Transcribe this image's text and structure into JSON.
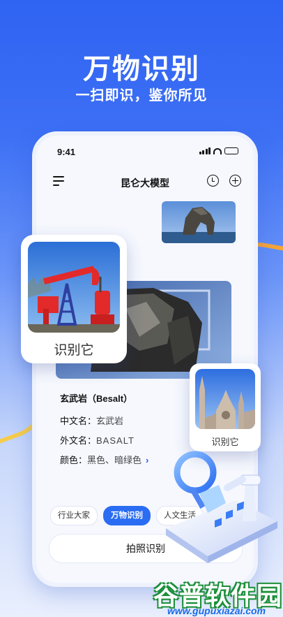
{
  "hero": {
    "title": "万物识别",
    "subtitle": "一扫即识，鉴你所见"
  },
  "status_bar": {
    "time": "9:41"
  },
  "nav": {
    "title": "昆仑大模型",
    "icons": [
      "menu-icon",
      "history-icon",
      "add-icon"
    ]
  },
  "result": {
    "title": "玄武岩（Besalt）",
    "fields": [
      {
        "label": "中文名：",
        "value": "玄武岩"
      },
      {
        "label": "外文名：",
        "value": "BASALT"
      },
      {
        "label": "颜色：",
        "value": "黑色、暗绿色"
      }
    ]
  },
  "floating_cards": {
    "pump_label": "识别它",
    "church_label": "识别它"
  },
  "tabs": [
    {
      "label": "行业大家",
      "active": false
    },
    {
      "label": "万物识别",
      "active": true
    },
    {
      "label": "人文生活",
      "active": false
    }
  ],
  "capture_button": "拍照识别",
  "watermark": {
    "title": "谷普软件园",
    "url": "www.gupuxiazai.com"
  },
  "colors": {
    "accent": "#2a6df2",
    "hero_bg": "#2f63f2",
    "watermark_green": "#1d8f3a"
  }
}
